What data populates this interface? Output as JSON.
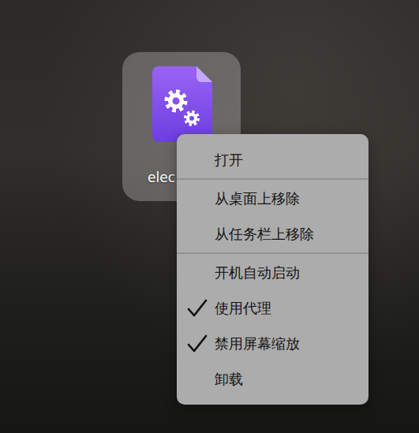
{
  "desktop_icon": {
    "label": "elec"
  },
  "context_menu": {
    "groups": [
      [
        {
          "label": "打开",
          "checked": false
        }
      ],
      [
        {
          "label": "从桌面上移除",
          "checked": false
        },
        {
          "label": "从任务栏上移除",
          "checked": false
        }
      ],
      [
        {
          "label": "开机自动启动",
          "checked": false
        },
        {
          "label": "使用代理",
          "checked": true
        },
        {
          "label": "禁用屏幕缩放",
          "checked": true
        },
        {
          "label": "卸载",
          "checked": false
        }
      ]
    ]
  }
}
